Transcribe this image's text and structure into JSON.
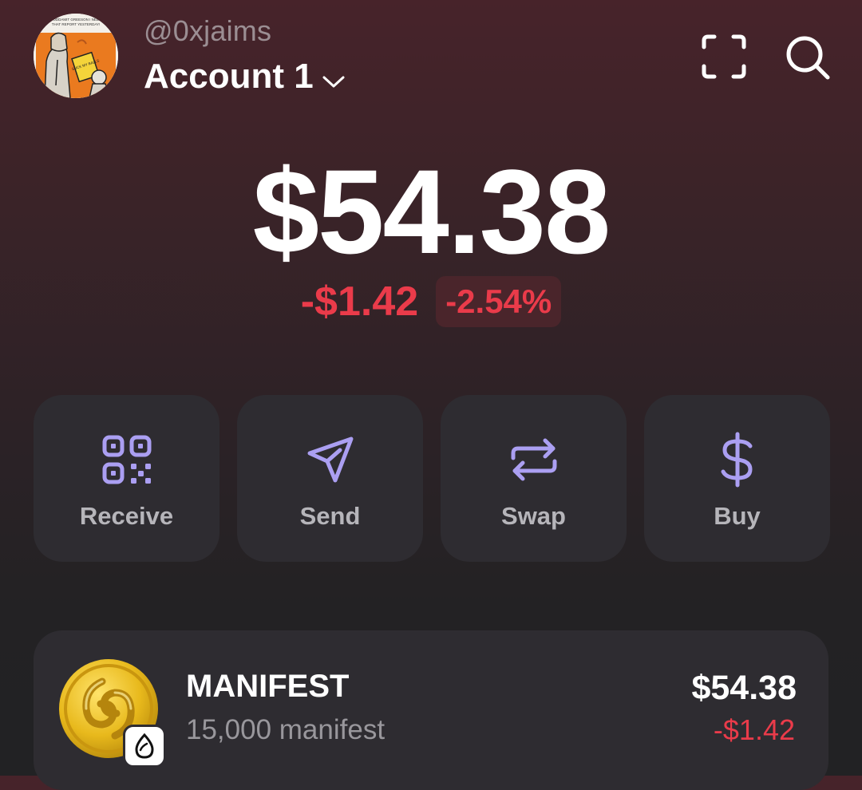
{
  "header": {
    "handle": "@0xjaims",
    "account_name": "Account 1",
    "avatar_alt": "Profile picture",
    "avatar_text_line1": "GODDAMIT GREESON I NEED",
    "avatar_text_line2": "THAT REPORT YESTERDAY!",
    "avatar_note_text": "SUCK MY BALLS"
  },
  "portfolio": {
    "balance": "$54.38",
    "change_abs": "-$1.42",
    "change_pct": "-2.54%",
    "negative_color": "#ea3b4a"
  },
  "actions": [
    {
      "label": "Receive",
      "icon": "qr-code-icon"
    },
    {
      "label": "Send",
      "icon": "paper-plane-icon"
    },
    {
      "label": "Swap",
      "icon": "swap-arrows-icon"
    },
    {
      "label": "Buy",
      "icon": "dollar-icon"
    }
  ],
  "accent_color": "#ab9ff2",
  "tokens": [
    {
      "name": "MANIFEST",
      "amount": "15,000 manifest",
      "value": "$54.38",
      "change": "-$1.42",
      "chain_icon": "sui-drop-icon"
    }
  ]
}
